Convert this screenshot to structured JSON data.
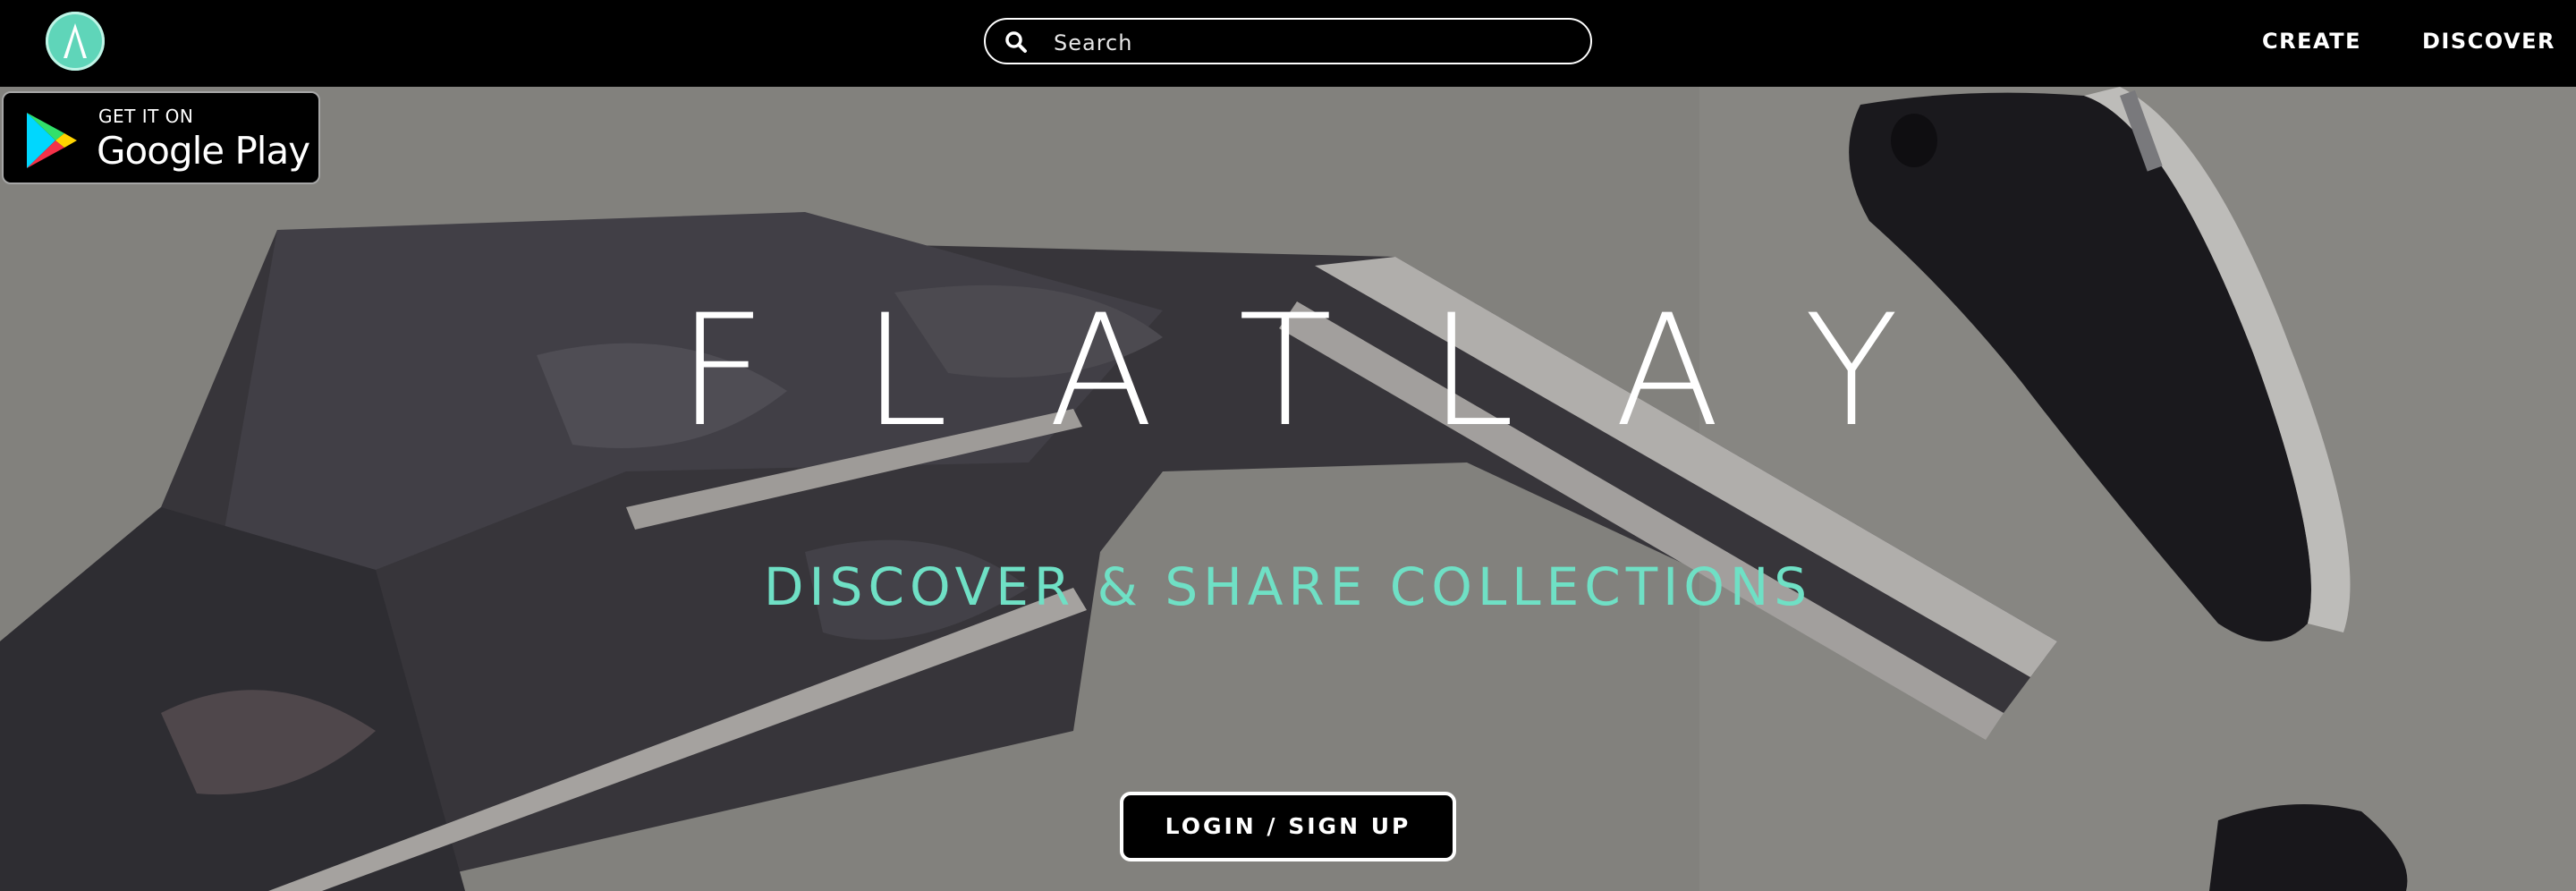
{
  "brand": {
    "logo_icon": "flatlay-logo-icon",
    "accent_color": "#6fe0c5"
  },
  "search": {
    "icon": "search-icon",
    "placeholder": "Search"
  },
  "nav": {
    "create_label": "CREATE",
    "discover_label": "DISCOVER"
  },
  "badge": {
    "icon": "google-play-icon",
    "small_text": "GET IT ON",
    "big_text": "Google Play"
  },
  "hero": {
    "title": "FLATLAY",
    "tagline": "DISCOVER & SHARE COLLECTIONS",
    "login_label": "LOGIN / SIGN UP"
  }
}
